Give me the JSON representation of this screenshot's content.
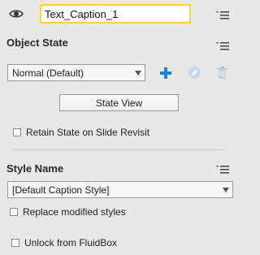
{
  "header": {
    "name_value": "Text_Caption_1"
  },
  "object_state": {
    "title": "Object State",
    "state_select": "Normal (Default)",
    "state_view_button": "State View",
    "retain_state_label": "Retain State on Slide Revisit"
  },
  "style": {
    "title": "Style Name",
    "style_select": "[Default Caption Style]",
    "replace_label": "Replace modified styles"
  },
  "fluidbox": {
    "unlock_label": "Unlock from FluidBox"
  },
  "colors": {
    "accent_blue": "#1f7fd0",
    "focus_outline": "#ffd633",
    "panel_bg": "#e8e8e8"
  },
  "icons": [
    "eye-icon",
    "panel-menu-icon",
    "add-state-icon",
    "edit-state-icon",
    "delete-state-icon",
    "dropdown-arrow-icon"
  ]
}
